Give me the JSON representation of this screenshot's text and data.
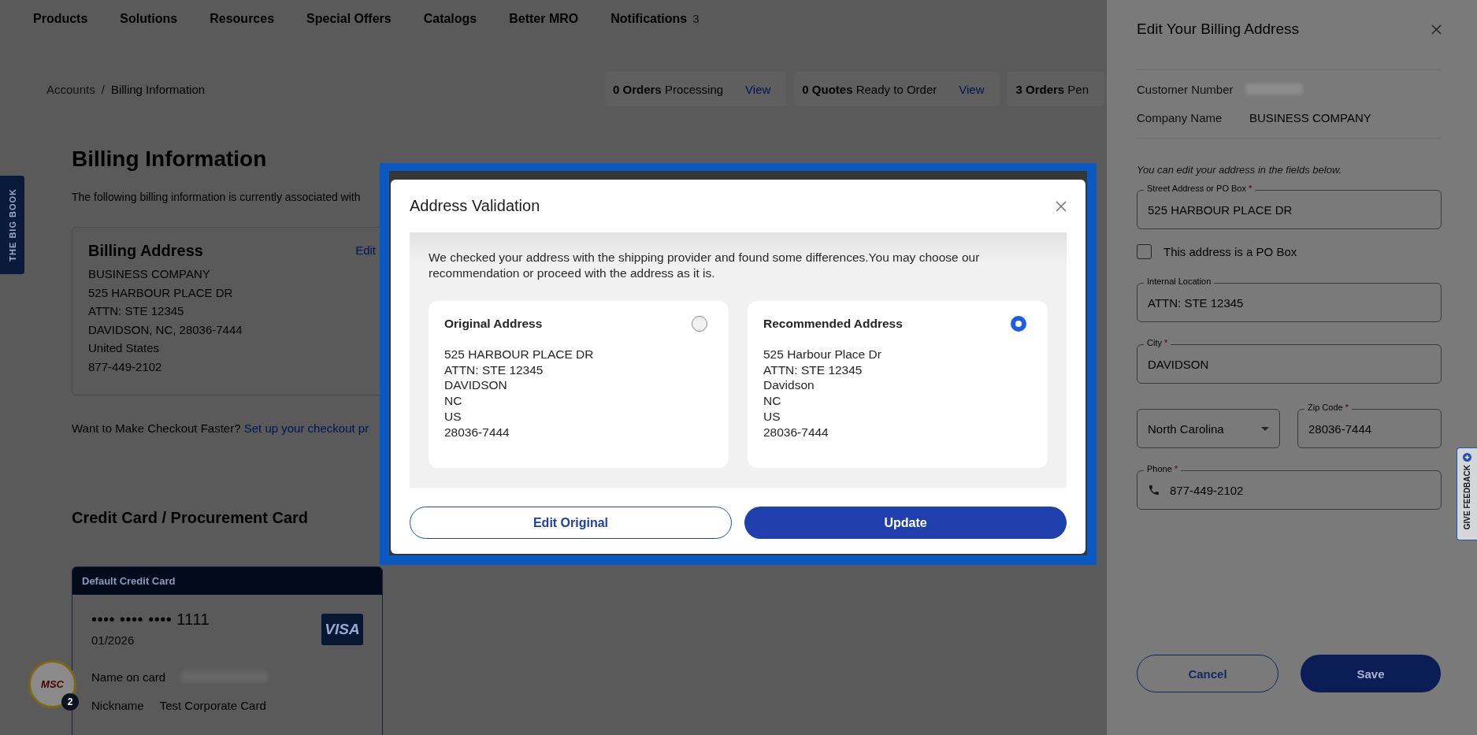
{
  "nav": {
    "items": [
      "Products",
      "Solutions",
      "Resources",
      "Special Offers",
      "Catalogs",
      "Better MRO"
    ],
    "notifications": {
      "label": "Notifications",
      "count": "3"
    }
  },
  "breadcrumb": {
    "items": [
      "Accounts",
      "Billing Information"
    ],
    "separator": "/"
  },
  "order_summary": [
    {
      "count": "0 Orders",
      "label": "Processing",
      "link": "View"
    },
    {
      "count": "0 Quotes",
      "label": "Ready to Order",
      "link": "View"
    },
    {
      "count": "3 Orders",
      "label": "Pen"
    }
  ],
  "side_tab": {
    "label": "THE BIG BOOK"
  },
  "page": {
    "title": "Billing Information",
    "description": "The following billing information is currently associated with",
    "billing_address": {
      "title": "Billing Address",
      "edit_link": "Edit",
      "lines": [
        "BUSINESS COMPANY",
        "525 HARBOUR PLACE DR",
        "ATTN: STE 12345",
        "DAVIDSON, NC, 28036-7444",
        "United States",
        "877-449-2102"
      ]
    },
    "checkout": {
      "prompt": "Want to Make Checkout Faster?",
      "link": "Set up your checkout pr"
    },
    "card_section": {
      "title": "Credit Card / Procurement Card",
      "card": {
        "header": "Default Credit Card",
        "dots": "•••• •••• ••••",
        "last4": "1111",
        "expiry": "01/2026",
        "brand": "VISA",
        "fields": [
          {
            "kind": "redacted",
            "label": "Name on card"
          },
          {
            "kind": "text",
            "label": "Nickname",
            "value": "Test Corporate Card"
          }
        ]
      }
    }
  },
  "chat": {
    "logo": "MSC",
    "badge": "2"
  },
  "drawer": {
    "title": "Edit Your Billing Address",
    "info": [
      {
        "kind": "redacted",
        "label": "Customer Number"
      },
      {
        "kind": "text",
        "label": "Company Name",
        "value": "BUSINESS COMPANY"
      }
    ],
    "note": "You can edit your address in the fields below.",
    "fields": [
      {
        "kind": "input",
        "label": "Street Address or PO Box",
        "required_mark": "*",
        "value": "525 HARBOUR PLACE DR"
      },
      {
        "kind": "checkbox",
        "label": "This address is a PO Box",
        "checked": false
      },
      {
        "kind": "input",
        "label": "Internal Location",
        "value": "ATTN: STE 12345"
      },
      {
        "kind": "input",
        "label": "City",
        "required_mark": "*",
        "value": "DAVIDSON"
      },
      {
        "kind": "pair",
        "select": {
          "value": "North Carolina"
        },
        "input": {
          "label": "Zip Code",
          "required_mark": "*",
          "value": "28036-7444"
        }
      },
      {
        "kind": "phone",
        "label": "Phone",
        "required_mark": "*",
        "value": "877-449-2102"
      }
    ],
    "buttons": {
      "cancel": "Cancel",
      "save": "Save"
    }
  },
  "feedback": {
    "label": "GIVE FEEDBACK"
  },
  "modal": {
    "title": "Address Validation",
    "message": "We checked your address with the shipping provider and found some differences.You may choose our recommendation or proceed with the address as it is.",
    "options": [
      {
        "title": "Original Address",
        "selected": false,
        "lines": [
          "525 HARBOUR PLACE DR",
          "ATTN: STE 12345",
          "DAVIDSON",
          "NC",
          "US",
          "28036-7444"
        ]
      },
      {
        "title": "Recommended Address",
        "selected": true,
        "lines": [
          "525 Harbour Place Dr",
          "ATTN: STE 12345",
          "Davidson",
          "NC",
          "US",
          "28036-7444"
        ]
      }
    ],
    "buttons": {
      "secondary": "Edit Original",
      "primary": "Update"
    }
  }
}
